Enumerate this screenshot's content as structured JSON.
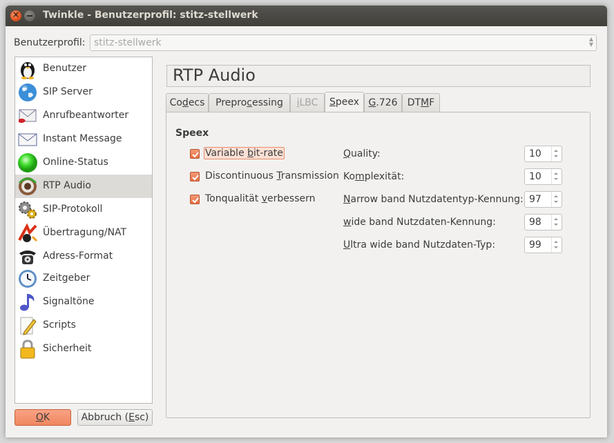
{
  "window": {
    "title": "Twinkle - Benutzerprofil: stitz-stellwerk",
    "close_glyph": "×"
  },
  "profile": {
    "label": "Benutzerprofil:",
    "value": "stitz-stellwerk"
  },
  "sidebar": {
    "selected": "RTP Audio",
    "items": [
      {
        "label": "Benutzer",
        "icon": "penguin-icon"
      },
      {
        "label": "SIP Server",
        "icon": "globe-icon"
      },
      {
        "label": "Anrufbeantworter",
        "icon": "voicemail-envelope-icon"
      },
      {
        "label": "Instant Message",
        "icon": "envelope-icon"
      },
      {
        "label": "Online-Status",
        "icon": "green-orb-icon"
      },
      {
        "label": "RTP Audio",
        "icon": "speaker-icon"
      },
      {
        "label": "SIP-Protokoll",
        "icon": "gears-icon"
      },
      {
        "label": "Übertragung/NAT",
        "icon": "network-transfer-icon"
      },
      {
        "label": "Adress-Format",
        "icon": "telephone-icon"
      },
      {
        "label": "Zeitgeber",
        "icon": "clock-icon"
      },
      {
        "label": "Signaltöne",
        "icon": "music-note-icon"
      },
      {
        "label": "Scripts",
        "icon": "pencil-paper-icon"
      },
      {
        "label": "Sicherheit",
        "icon": "padlock-icon"
      }
    ]
  },
  "buttons": {
    "ok": {
      "pre": "",
      "key": "O",
      "post": "K"
    },
    "cancel": {
      "pre": "Abbruch (",
      "key": "E",
      "post": "sc)"
    }
  },
  "page": {
    "title": "RTP Audio"
  },
  "tabs": [
    {
      "pre": "Co",
      "key": "d",
      "post": "ecs",
      "state": "normal"
    },
    {
      "pre": "Prepro",
      "key": "c",
      "post": "essing",
      "state": "normal"
    },
    {
      "pre": "",
      "key": "i",
      "post": "LBC",
      "state": "disabled"
    },
    {
      "pre": "",
      "key": "S",
      "post": "peex",
      "state": "active"
    },
    {
      "pre": "",
      "key": "G",
      "post": ".726",
      "state": "normal"
    },
    {
      "pre": "DT",
      "key": "M",
      "post": "F",
      "state": "normal"
    }
  ],
  "speex": {
    "section_title": "Speex",
    "checkboxes": [
      {
        "pre": "Variable ",
        "key": "b",
        "post": "it-rate",
        "checked": true
      },
      {
        "pre": "Discontinuous ",
        "key": "T",
        "post": "ransmission",
        "checked": true
      },
      {
        "pre": "Tonqualität ",
        "key": "v",
        "post": "erbessern",
        "checked": true
      }
    ],
    "fields": [
      {
        "pre": "",
        "key": "Q",
        "post": "uality:",
        "value": "10"
      },
      {
        "pre": "Ko",
        "key": "m",
        "post": "plexität:",
        "value": "10"
      },
      {
        "pre": "",
        "key": "N",
        "post": "arrow band Nutzdatentyp-Kennung:",
        "value": "97"
      },
      {
        "pre": "",
        "key": "w",
        "post": "ide band Nutzdaten-Kennung:",
        "value": "98"
      },
      {
        "pre": "",
        "key": "U",
        "post": "ltra wide band Nutzdaten-Typ:",
        "value": "99"
      }
    ]
  },
  "colors": {
    "accent": "#f0875f",
    "titlebar": "#45443f",
    "window_bg": "#f2f1f0"
  }
}
